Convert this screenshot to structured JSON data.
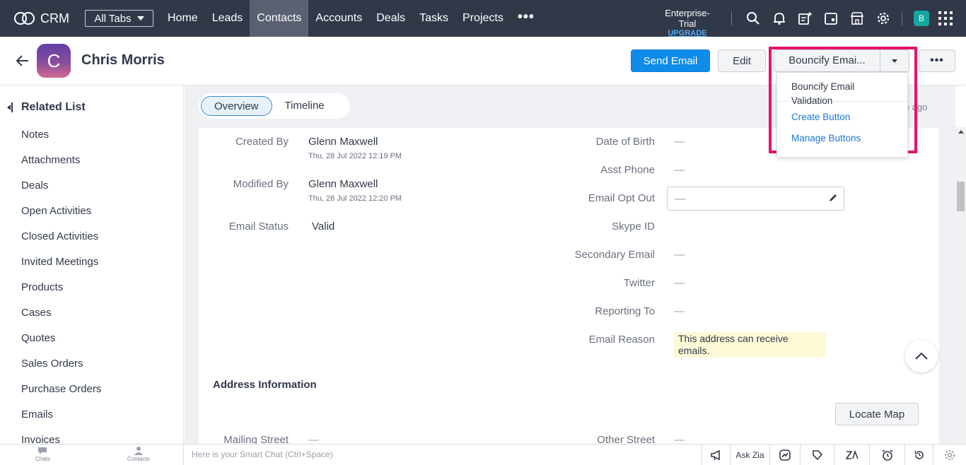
{
  "topnav": {
    "app_name": "CRM",
    "all_tabs_label": "All Tabs",
    "tabs": [
      {
        "label": "Home"
      },
      {
        "label": "Leads"
      },
      {
        "label": "Contacts",
        "active": true
      },
      {
        "label": "Accounts"
      },
      {
        "label": "Deals"
      },
      {
        "label": "Tasks"
      },
      {
        "label": "Projects"
      }
    ],
    "more_label": "•••",
    "edition": "Enterprise-Trial",
    "upgrade_label": "UPGRADE",
    "user_initial": "B",
    "icons": [
      "search-icon",
      "bell-icon",
      "add-note-icon",
      "calendar-icon",
      "marketplace-icon",
      "gear-icon",
      "apps-grid-icon"
    ]
  },
  "record": {
    "avatar_letter": "C",
    "name": "Chris Morris",
    "send_email_label": "Send Email",
    "edit_label": "Edit",
    "bouncify_label": "Bouncify Emai...",
    "more_label": "•••"
  },
  "dropdown": {
    "items": [
      "Bouncify Email Validation",
      "Create Button",
      "Manage Buttons"
    ]
  },
  "sidebar": {
    "title": "Related List",
    "items": [
      "Notes",
      "Attachments",
      "Deals",
      "Open Activities",
      "Closed Activities",
      "Invited Meetings",
      "Products",
      "Cases",
      "Quotes",
      "Sales Orders",
      "Purchase Orders",
      "Emails",
      "Invoices"
    ]
  },
  "main": {
    "tabs": [
      "Overview",
      "Timeline"
    ],
    "updated_fragment": "ile ago",
    "left_fields": {
      "created_by_label": "Created By",
      "created_by_value": "Glenn Maxwell",
      "created_by_time": "Thu, 28 Jul 2022 12:19 PM",
      "modified_by_label": "Modified By",
      "modified_by_value": "Glenn Maxwell",
      "modified_by_time": "Thu, 28 Jul 2022 12:20 PM",
      "email_status_label": "Email Status",
      "email_status_value": "Valid"
    },
    "right_fields": {
      "dob_label": "Date of Birth",
      "asst_phone_label": "Asst Phone",
      "email_opt_out_label": "Email Opt Out",
      "skype_label": "Skype ID",
      "secondary_email_label": "Secondary Email",
      "twitter_label": "Twitter",
      "reporting_to_label": "Reporting To",
      "email_reason_label": "Email Reason",
      "email_reason_value": "This address can receive emails."
    },
    "empty_value": "—",
    "address_title": "Address Information",
    "locate_map_label": "Locate Map",
    "mailing_street_label": "Mailing Street",
    "other_street_label": "Other Street"
  },
  "bottombar": {
    "chats_label": "Chats",
    "contacts_label": "Contacts",
    "smart_chat_placeholder": "Here is your Smart Chat (Ctrl+Space)",
    "ask_zia_label": "Ask Zia"
  },
  "colors": {
    "nav_bg": "#313949",
    "primary": "#0f8bea",
    "highlight": "#e5146c",
    "link": "#1b78d6"
  }
}
